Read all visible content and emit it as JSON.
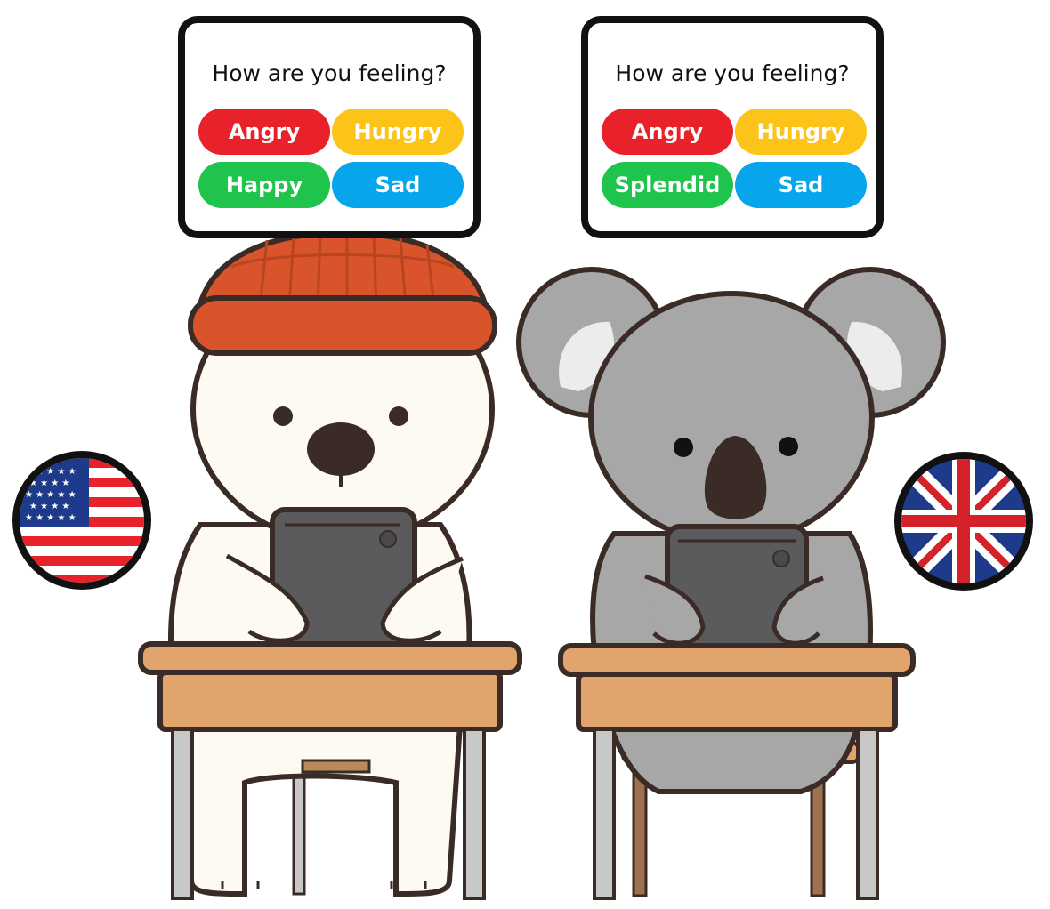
{
  "cards": [
    {
      "question": "How are you feeling?",
      "choices": [
        {
          "label": "Angry",
          "color": "#e8212b"
        },
        {
          "label": "Hungry",
          "color": "#fcc419"
        },
        {
          "label": "Happy",
          "color": "#1fc44c"
        },
        {
          "label": "Sad",
          "color": "#07a6ec"
        }
      ]
    },
    {
      "question": "How are you feeling?",
      "choices": [
        {
          "label": "Angry",
          "color": "#e8212b"
        },
        {
          "label": "Hungry",
          "color": "#fcc419"
        },
        {
          "label": "Splendid",
          "color": "#1fc44c"
        },
        {
          "label": "Sad",
          "color": "#07a6ec"
        }
      ]
    }
  ],
  "characters": {
    "left": {
      "animal": "polar-bear",
      "hat_color": "#d9542a",
      "fur_color": "#fdfbf1",
      "flag": "usa-flag-icon"
    },
    "right": {
      "animal": "koala",
      "fur_color": "#a7a7a8",
      "flag": "uk-flag-icon"
    }
  },
  "colors": {
    "desk_top": "#e0a46c",
    "desk_leg": "#c8c8c8",
    "tablet": "#5b5a5d",
    "outline": "#3a2b27"
  }
}
